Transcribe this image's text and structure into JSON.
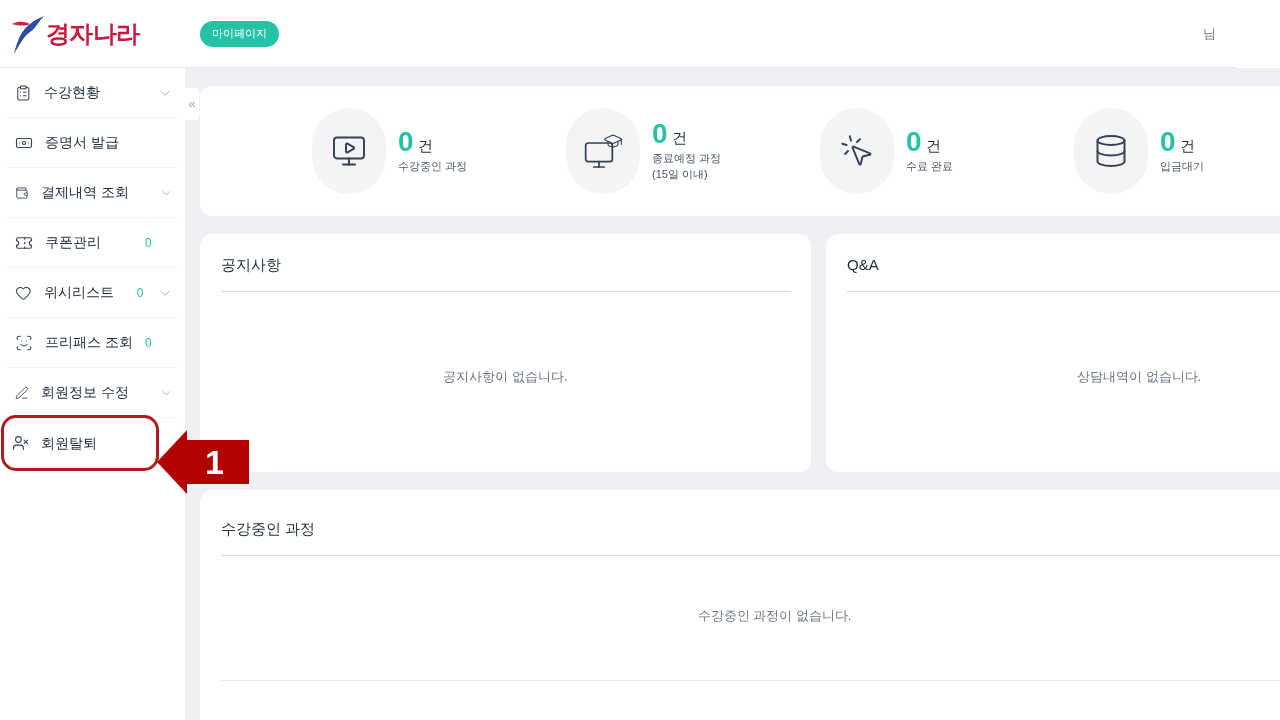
{
  "header": {
    "logo_text": "경자나라",
    "mypage_button": "마이페이지",
    "user": "님"
  },
  "sidebar": {
    "items": [
      {
        "label": "수강현황",
        "expandable": true,
        "highlighted": false
      },
      {
        "label": "증명서 발급",
        "expandable": false,
        "highlighted": false
      },
      {
        "label": "결제내역 조회",
        "expandable": true,
        "highlighted": false
      },
      {
        "label": "쿠폰관리",
        "count": "0",
        "expandable": false,
        "highlighted": false
      },
      {
        "label": "위시리스트",
        "count": "0",
        "expandable": true,
        "highlighted": false
      },
      {
        "label": "프리패스 조회",
        "count": "0",
        "expandable": false,
        "highlighted": false
      },
      {
        "label": "회원정보 수정",
        "expandable": true,
        "highlighted": false
      },
      {
        "label": "회원탈퇴",
        "expandable": false,
        "highlighted": true
      }
    ],
    "collapse_glyph": "«"
  },
  "stats": [
    {
      "value": "0",
      "unit": "건",
      "label_lines": [
        "수강중인 과정"
      ]
    },
    {
      "value": "0",
      "unit": "건",
      "label_lines": [
        "종료예정 과정",
        "(15일 이내)"
      ]
    },
    {
      "value": "0",
      "unit": "건",
      "label_lines": [
        "수료 완료"
      ]
    },
    {
      "value": "0",
      "unit": "건",
      "label_lines": [
        "입금대기"
      ]
    }
  ],
  "notice": {
    "title": "공지사항",
    "empty": "공지사항이 없습니다."
  },
  "qna": {
    "title": "Q&A",
    "empty": "상담내역이 없습니다."
  },
  "courses": {
    "title": "수강중인 과정",
    "empty": "수강중인 과정이 없습니다."
  },
  "callout": {
    "number": "1"
  }
}
